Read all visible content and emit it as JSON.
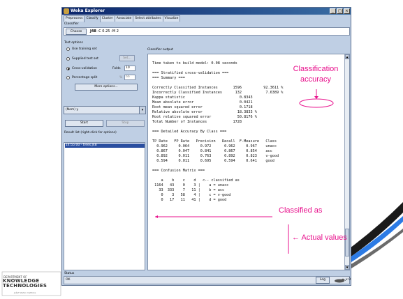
{
  "window": {
    "title": "Weka Explorer"
  },
  "tabs": [
    "Preprocess",
    "Classify",
    "Cluster",
    "Associate",
    "Select attributes",
    "Visualize"
  ],
  "active_tab": "Classify",
  "classifier": {
    "section_label": "Classifier",
    "choose_label": "Choose",
    "name": "J48",
    "options": "-C 0.25 -M 2"
  },
  "test_options": {
    "section_label": "Test options",
    "use_training": "Use training set",
    "supplied_test": "Supplied test set",
    "set_label": "Set...",
    "cross_validation": "Cross-validation",
    "folds_label": "Folds",
    "folds_value": "10",
    "percentage_split": "Percentage split",
    "percent_sign": "%",
    "percent_value": "66",
    "more_options": "More options..."
  },
  "class_select": "(Nom) y",
  "start_label": "Start",
  "stop_label": "Stop",
  "result_list": {
    "label": "Result list (right-click for options)",
    "items": [
      "14:55:00 - trees.J48"
    ]
  },
  "output": {
    "label": "Classifier output",
    "lines": [
      "Time taken to build model: 0.08 seconds",
      "",
      "=== Stratified cross-validation ===",
      "=== Summary ===",
      "",
      "Correctly Classified Instances       1596          92.3611 %",
      "Incorrectly Classified Instances      132           7.6389 %",
      "Kappa statistic                         0.8343",
      "Mean absolute error                     0.0421",
      "Root mean squared error                 0.1718",
      "Relative absolute error                18.3833 %",
      "Root relative squared error            50.8176 %",
      "Total Number of Instances            1728",
      "",
      "=== Detailed Accuracy By Class ===",
      "",
      "TP Rate   FP Rate   Precision   Recall  F-Measure   Class",
      "  0.962     0.064     0.972      0.962     0.967    unacc",
      "  0.867     0.047     0.841      0.867     0.854    acc",
      "  0.892     0.011     0.763      0.892     0.823    v-good",
      "  0.594     0.011     0.695      0.594     0.641    good",
      "",
      "=== Confusion Matrix ===",
      "",
      "    a    b    c    d   <-- classified as",
      " 1164   43    0    3 |    a = unacc",
      "   33  333    7   11 |    b = acc",
      "    0    3   58    4 |    c = v-good",
      "    0   17   11   41 |    d = good"
    ]
  },
  "status": {
    "label": "Status",
    "text": "OK",
    "log_label": "Log",
    "count": "x 0"
  },
  "annotations": {
    "accuracy": "Classification accuracy",
    "classified_as": "Classified as",
    "actual_values": "← Actual values"
  },
  "logo": {
    "top": "DEPARTMENT OF",
    "main": "KNOWLEDGE TECHNOLOGIES",
    "sub": "Jožef Stefan Institute"
  },
  "colors": {
    "annotation": "#e8108c",
    "window_bg": "#bfcfe4",
    "selection": "#2a4ea0"
  }
}
